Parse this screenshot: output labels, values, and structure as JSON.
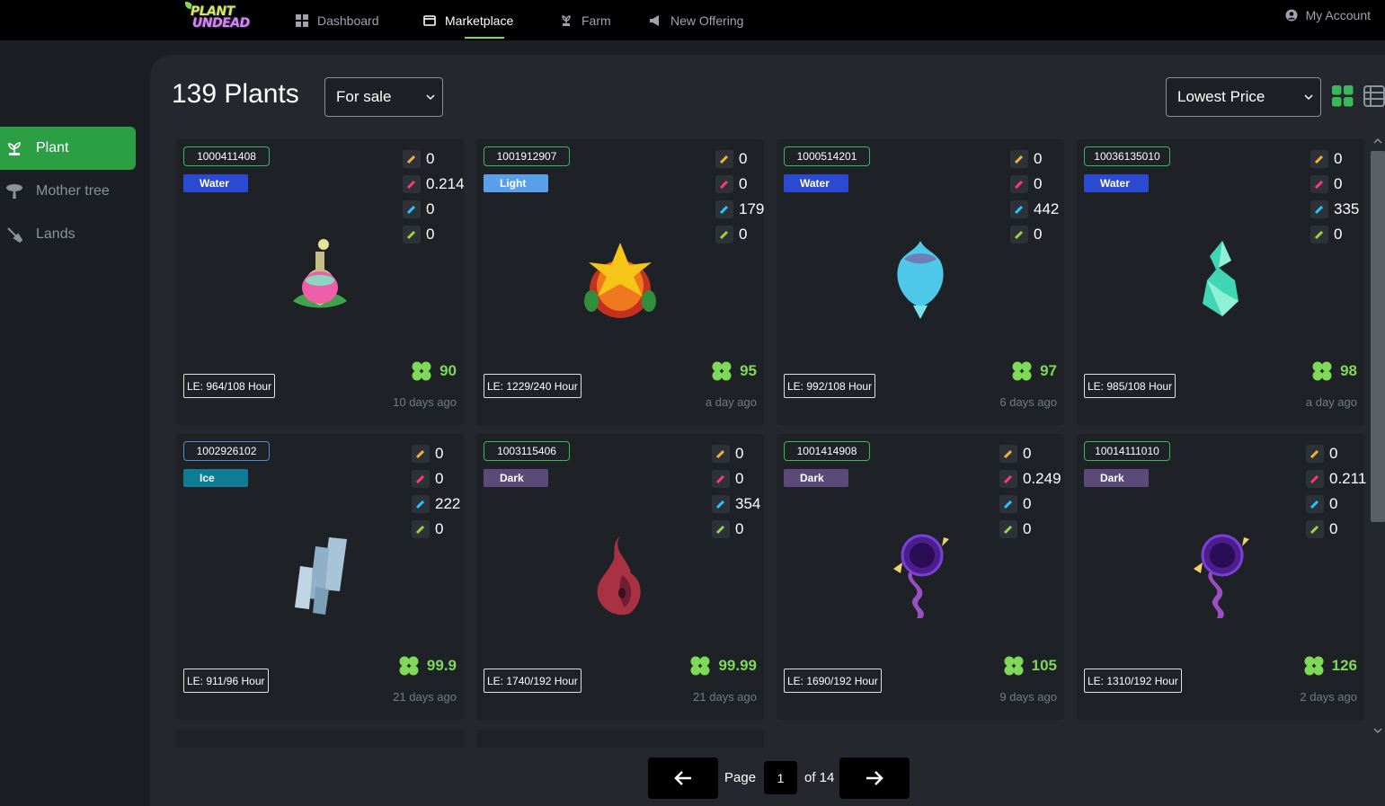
{
  "nav": {
    "logo_line1": "PLANT",
    "logo_line2": "UNDEAD",
    "items": [
      {
        "label": "Dashboard",
        "icon": "dashboard-icon"
      },
      {
        "label": "Marketplace",
        "icon": "marketplace-icon"
      },
      {
        "label": "Farm",
        "icon": "farm-icon"
      },
      {
        "label": "New Offering",
        "icon": "megaphone-icon"
      }
    ],
    "active": "Marketplace",
    "account_label": "My Account"
  },
  "sidebar": {
    "items": [
      {
        "label": "Plant",
        "active": true
      },
      {
        "label": "Mother tree",
        "active": false
      },
      {
        "label": "Lands",
        "active": false
      }
    ]
  },
  "header": {
    "title": "139 Plants",
    "filter_value": "For sale",
    "sort_value": "Lowest Price"
  },
  "colors": {
    "accent": "#2c9f45",
    "price": "#7ed957",
    "water": "#2a4bd1",
    "light": "#5aa0e8",
    "ice": "#0f7c95",
    "dark": "#5b4a78"
  },
  "cards": [
    {
      "id": "1000411408",
      "element": "Water",
      "stats": [
        "0",
        "0.214",
        "0",
        "0"
      ],
      "le": "LE: 964/108 Hour",
      "price": "90",
      "age": "10 days ago"
    },
    {
      "id": "1001912907",
      "element": "Light",
      "stats": [
        "0",
        "0",
        "179",
        "0"
      ],
      "le": "LE: 1229/240 Hour",
      "price": "95",
      "age": "a day ago"
    },
    {
      "id": "1000514201",
      "element": "Water",
      "stats": [
        "0",
        "0",
        "442",
        "0"
      ],
      "le": "LE: 992/108 Hour",
      "price": "97",
      "age": "6 days ago"
    },
    {
      "id": "10036135010",
      "element": "Water",
      "stats": [
        "0",
        "0",
        "335",
        "0"
      ],
      "le": "LE: 985/108 Hour",
      "price": "98",
      "age": "a day ago"
    },
    {
      "id": "1002926102",
      "element": "Ice",
      "stats": [
        "0",
        "0",
        "222",
        "0"
      ],
      "le": "LE: 911/96 Hour",
      "price": "99.9",
      "age": "21 days ago"
    },
    {
      "id": "1003115406",
      "element": "Dark",
      "stats": [
        "0",
        "0",
        "354",
        "0"
      ],
      "le": "LE: 1740/192 Hour",
      "price": "99.99",
      "age": "21 days ago"
    },
    {
      "id": "1001414908",
      "element": "Dark",
      "stats": [
        "0",
        "0.249",
        "0",
        "0"
      ],
      "le": "LE: 1690/192 Hour",
      "price": "105",
      "age": "9 days ago"
    },
    {
      "id": "10014111010",
      "element": "Dark",
      "stats": [
        "0",
        "0.211",
        "0",
        "0"
      ],
      "le": "LE: 1310/192 Hour",
      "price": "126",
      "age": "2 days ago"
    }
  ],
  "pagination": {
    "page_label": "Page",
    "current": "1",
    "of_label": "of 14"
  }
}
